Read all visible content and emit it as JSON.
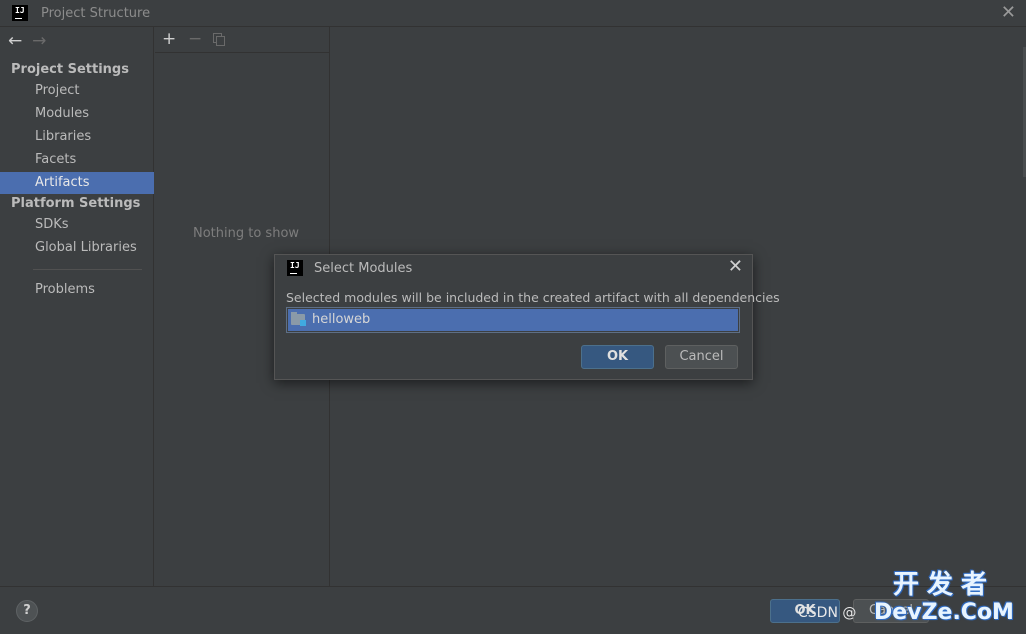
{
  "window": {
    "logo_text": "IJ",
    "title": "Project Structure",
    "close_glyph": "✕"
  },
  "nav": {
    "back_glyph": "←",
    "forward_glyph": "→"
  },
  "sidebar": {
    "project_settings_title": "Project Settings",
    "project_items": [
      "Project",
      "Modules",
      "Libraries",
      "Facets",
      "Artifacts"
    ],
    "selected_item": "Artifacts",
    "platform_settings_title": "Platform Settings",
    "platform_items": [
      "SDKs",
      "Global Libraries"
    ],
    "problems_label": "Problems"
  },
  "middle": {
    "add_glyph": "+",
    "remove_glyph": "−",
    "empty_text": "Nothing to show"
  },
  "bottom": {
    "help_glyph": "?",
    "ok_label": "OK",
    "cancel_label": "Cancel"
  },
  "watermark": {
    "csdn": "CSDN @",
    "site_cn": "开发者",
    "site_en": "DevZe.CoM"
  },
  "dialog": {
    "logo_text": "IJ",
    "title": "Select Modules",
    "close_glyph": "✕",
    "description": "Selected modules will be included in the created artifact with all dependencies",
    "modules": [
      "helloweb"
    ],
    "ok_label": "OK",
    "cancel_label": "Cancel"
  },
  "colors": {
    "background": "#3c3f41",
    "selection": "#4b6eaf",
    "primary_button": "#365880",
    "text": "#bbbbbb"
  },
  "icons": {
    "window_logo": "intellij-logo-icon",
    "module_icon": "module-folder-icon",
    "copy_icon": "copy-icon"
  }
}
